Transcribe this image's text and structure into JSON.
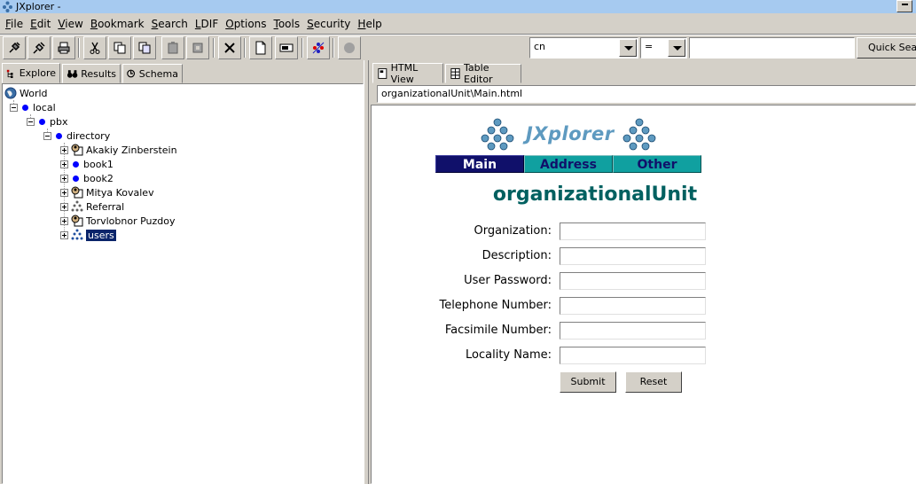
{
  "window": {
    "title": "JXplorer -"
  },
  "menu": [
    {
      "mnemonic": "F",
      "rest": "ile"
    },
    {
      "mnemonic": "E",
      "rest": "dit"
    },
    {
      "mnemonic": "V",
      "rest": "iew"
    },
    {
      "mnemonic": "B",
      "rest": "ookmark"
    },
    {
      "mnemonic": "S",
      "rest": "earch"
    },
    {
      "mnemonic": "L",
      "rest": "DIF"
    },
    {
      "mnemonic": "O",
      "rest": "ptions"
    },
    {
      "mnemonic": "T",
      "rest": "ools"
    },
    {
      "mnemonic": "S",
      "rest": "ecurity"
    },
    {
      "mnemonic": "H",
      "rest": "elp"
    }
  ],
  "toolbar": {
    "attribute_combo": "cn",
    "operator_combo": "=",
    "search_value": "",
    "quick_search_label": "Quick Search"
  },
  "left_tabs": [
    "Explore",
    "Results",
    "Schema"
  ],
  "tree": {
    "root": "World",
    "local": "local",
    "pbx": "pbx",
    "directory": "directory",
    "children": [
      "Akakiy Zinberstein",
      "book1",
      "book2",
      "Mitya Kovalev",
      "Referral",
      "Torvlobnor Puzdoy",
      "users"
    ]
  },
  "right_tabs": [
    "HTML View",
    "Table Editor"
  ],
  "url": "organizationalUnit\\Main.html",
  "html_view": {
    "logo_text": "JXplorer",
    "nav": [
      "Main",
      "Address",
      "Other"
    ],
    "heading": "organizationalUnit",
    "fields": [
      "Organization:",
      "Description:",
      "User Password:",
      "Telephone Number:",
      "Facsimile Number:",
      "Locality Name:"
    ],
    "submit_label": "Submit",
    "reset_label": "Reset"
  },
  "colors": {
    "title_bar": "#a6caf0",
    "selection": "#0a246a",
    "heading": "#006060",
    "nav_main": "#10106a",
    "nav_teal": "#10a0a0",
    "logo": "#5e9ac0"
  }
}
